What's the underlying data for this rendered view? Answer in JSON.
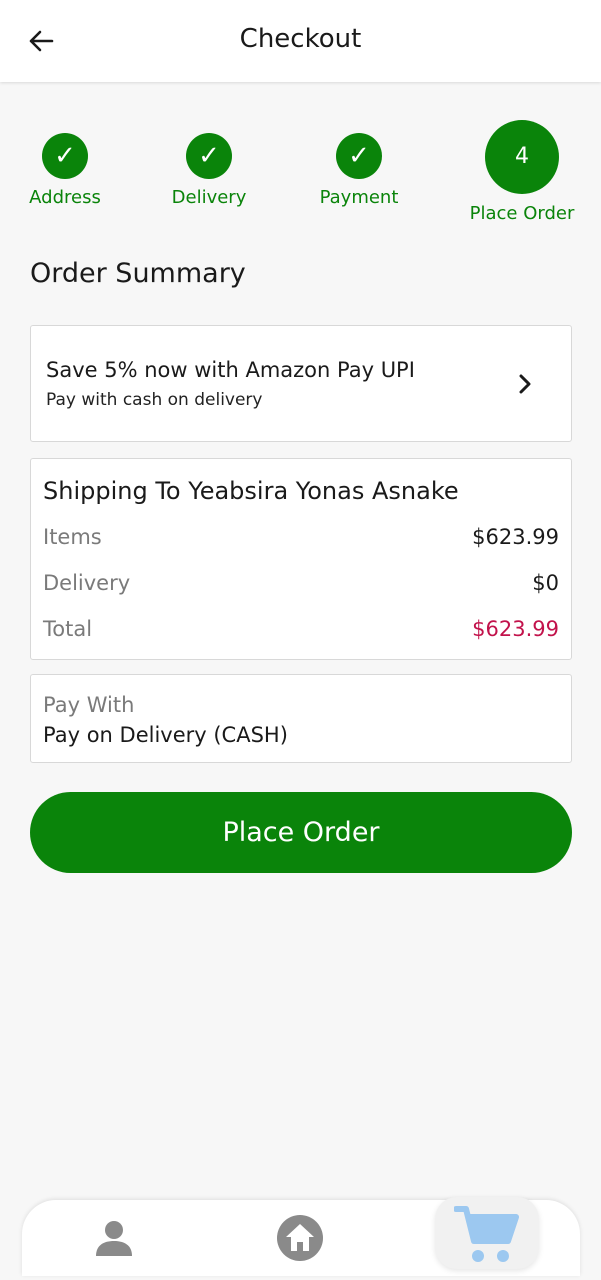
{
  "header": {
    "title": "Checkout",
    "back_icon": "arrow-left-icon"
  },
  "stepper": {
    "steps": [
      {
        "label": "Address",
        "state": "done",
        "icon": "check-icon",
        "glyph": "✓"
      },
      {
        "label": "Delivery",
        "state": "done",
        "icon": "check-icon",
        "glyph": "✓"
      },
      {
        "label": "Payment",
        "state": "done",
        "icon": "check-icon",
        "glyph": "✓"
      },
      {
        "label": "Place Order",
        "state": "current",
        "number": "4"
      }
    ]
  },
  "summary": {
    "title": "Order Summary"
  },
  "promo": {
    "title": "Save 5% now with Amazon Pay UPI",
    "subtitle": "Pay with cash on delivery",
    "icon": "chevron-right-icon"
  },
  "shipping": {
    "title": "Shipping To Yeabsira Yonas Asnake",
    "items_label": "Items",
    "items_value": "$623.99",
    "delivery_label": "Delivery",
    "delivery_value": "$0",
    "total_label": "Total",
    "total_value": "$623.99"
  },
  "payment": {
    "label": "Pay With",
    "method": "Pay on Delivery (CASH)"
  },
  "action": {
    "place_order": "Place Order"
  },
  "bottom_nav": {
    "items": [
      {
        "icon": "person-icon",
        "active": false
      },
      {
        "icon": "home-icon",
        "active": false
      },
      {
        "icon": "cart-icon",
        "active": true
      }
    ]
  },
  "colors": {
    "accent": "#0a840a",
    "total": "#c2124b",
    "cart_active": "#9cc8f0"
  }
}
